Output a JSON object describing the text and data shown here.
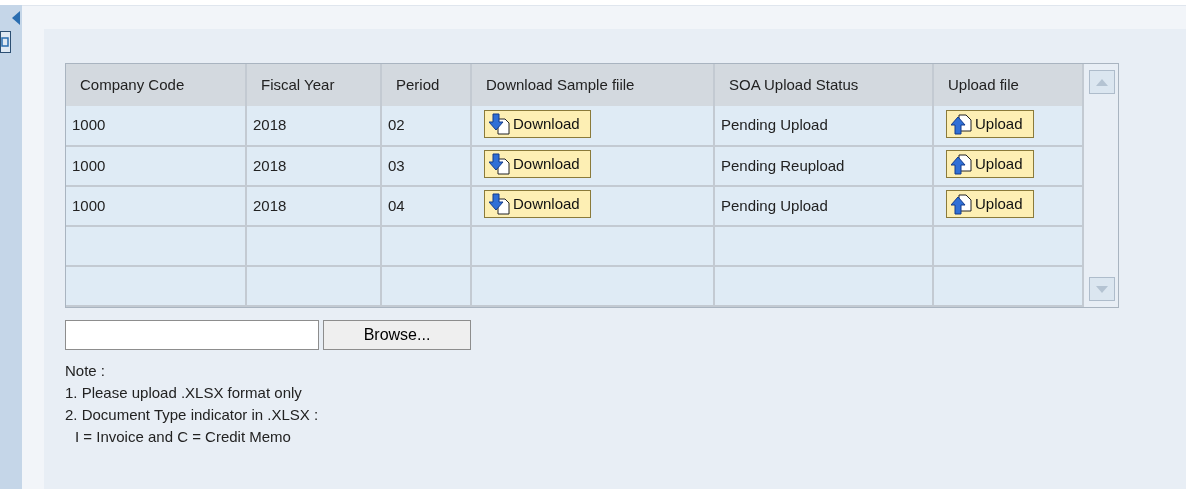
{
  "table": {
    "columns": [
      "Company Code",
      "Fiscal Year",
      "Period",
      "Download Sample fiile",
      "SOA Upload Status",
      "Upload file"
    ],
    "rows": [
      {
        "company_code": "1000",
        "fiscal_year": "2018",
        "period": "02",
        "download": "Download",
        "status": "Pending Upload",
        "upload": "Upload"
      },
      {
        "company_code": "1000",
        "fiscal_year": "2018",
        "period": "03",
        "download": "Download",
        "status": "Pending Reupload",
        "upload": "Upload"
      },
      {
        "company_code": "1000",
        "fiscal_year": "2018",
        "period": "04",
        "download": "Download",
        "status": "Pending Upload",
        "upload": "Upload"
      }
    ]
  },
  "file_input": {
    "button": "Browse..."
  },
  "note": {
    "title": "Note :",
    "lines": [
      {
        "text": "1. Please upload .XLSX format only"
      },
      {
        "text": "2. Document Type indicator in .XLSX :",
        "children": [
          {
            "text": "I = Invoice and C = Credit Memo"
          }
        ]
      }
    ]
  }
}
